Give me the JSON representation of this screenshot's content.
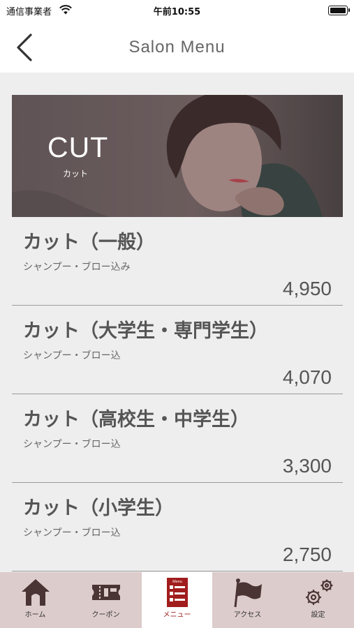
{
  "status_bar": {
    "carrier": "通信事業者",
    "time": "午前10:55"
  },
  "nav": {
    "title": "Salon Menu"
  },
  "banner": {
    "title": "CUT",
    "subtitle": "カット"
  },
  "menu_items": [
    {
      "name": "カット（一般）",
      "description": "シャンプー・ブロー込み",
      "price": "4,950"
    },
    {
      "name": "カット（大学生・専門学生）",
      "description": "シャンプー・ブロー込",
      "price": "4,070"
    },
    {
      "name": "カット（高校生・中学生）",
      "description": "シャンプー・ブロー込",
      "price": "3,300"
    },
    {
      "name": "カット（小学生）",
      "description": "シャンプー・ブロー込",
      "price": "2,750"
    }
  ],
  "tabs": [
    {
      "label": "ホーム",
      "icon": "home-icon"
    },
    {
      "label": "クーポン",
      "icon": "coupon-icon"
    },
    {
      "label": "メニュー",
      "icon": "menu-icon",
      "active": true,
      "icon_text": "Menu"
    },
    {
      "label": "アクセス",
      "icon": "flag-icon"
    },
    {
      "label": "設定",
      "icon": "gear-icon"
    }
  ],
  "colors": {
    "accent": "#a11c1c",
    "tab_bar": "#dccccb",
    "content_bg": "#eeeeee",
    "icon": "#4a3434"
  }
}
